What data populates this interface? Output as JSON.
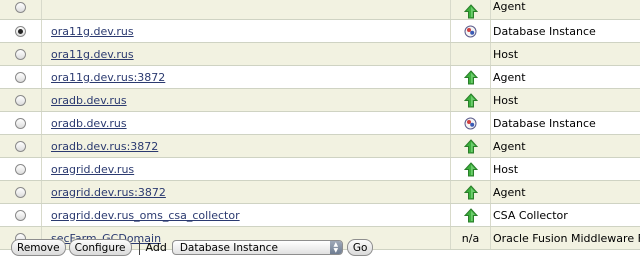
{
  "rows": [
    {
      "selected": false,
      "name": "",
      "status": "up",
      "type": "Agent"
    },
    {
      "selected": true,
      "name": "ora11g.dev.rus",
      "status": "pending",
      "type": "Database Instance"
    },
    {
      "selected": false,
      "name": "ora11g.dev.rus",
      "status": "",
      "type": "Host"
    },
    {
      "selected": false,
      "name": "ora11g.dev.rus:3872",
      "status": "up",
      "type": "Agent"
    },
    {
      "selected": false,
      "name": "oradb.dev.rus",
      "status": "up",
      "type": "Host"
    },
    {
      "selected": false,
      "name": "oradb.dev.rus",
      "status": "pending",
      "type": "Database Instance"
    },
    {
      "selected": false,
      "name": "oradb.dev.rus:3872",
      "status": "up",
      "type": "Agent"
    },
    {
      "selected": false,
      "name": "oragrid.dev.rus",
      "status": "up",
      "type": "Host"
    },
    {
      "selected": false,
      "name": "oragrid.dev.rus:3872",
      "status": "up",
      "type": "Agent"
    },
    {
      "selected": false,
      "name": "oragrid.dev.rus_oms_csa_collector",
      "status": "up",
      "type": "CSA Collector"
    },
    {
      "selected": false,
      "name": "secFarm_GCDomain",
      "status": "n/a",
      "type": "Oracle Fusion Middleware Farm"
    }
  ],
  "toolbar": {
    "remove_label": "Remove",
    "configure_label": "Configure",
    "add_label": "Add",
    "add_select_value": "Database Instance",
    "go_label": "Go"
  },
  "icons": {
    "up": "green-up-arrow-icon",
    "pending": "status-pending-icon"
  },
  "colors": {
    "row_alt_bg": "#f2f2e1",
    "link": "#2b3a70",
    "up_arrow": "#3cb03c"
  }
}
